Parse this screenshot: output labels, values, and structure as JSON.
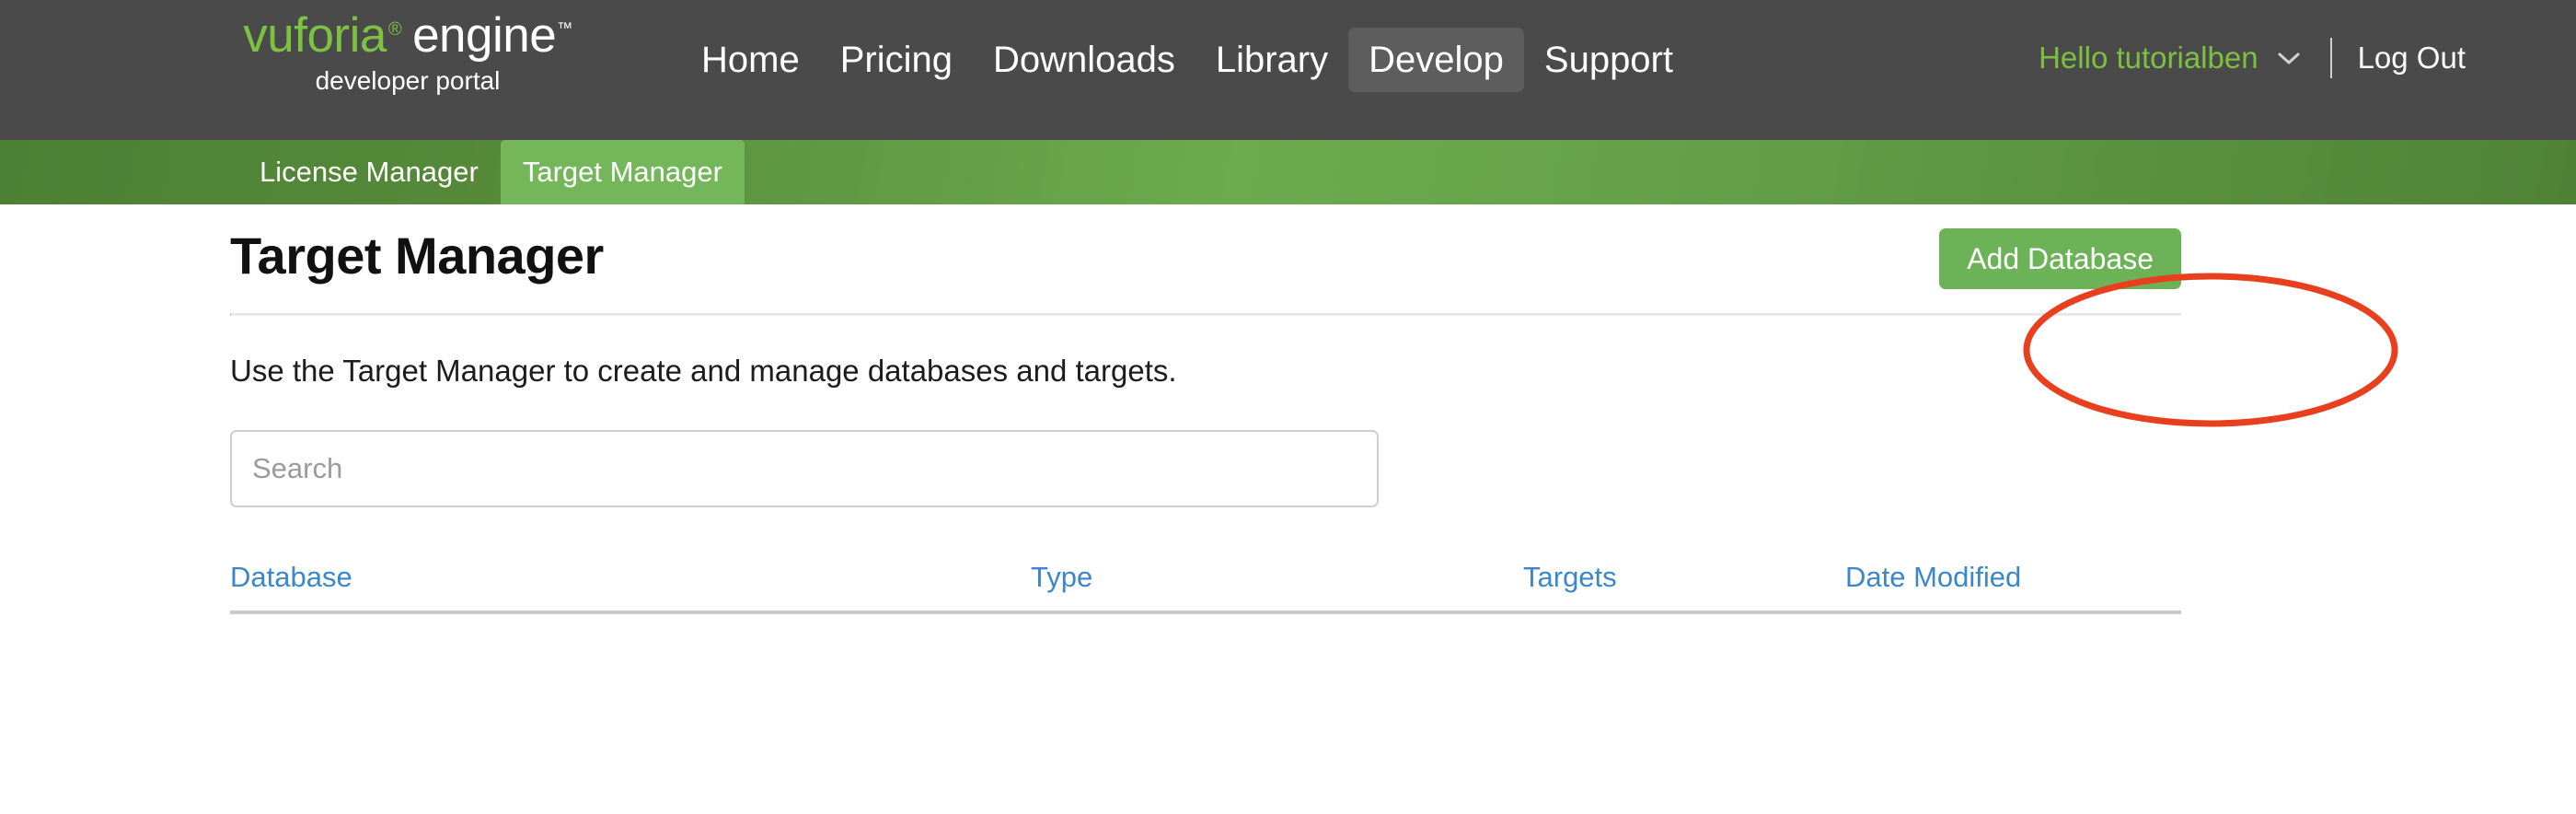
{
  "header": {
    "logo": {
      "brand": "vuforia",
      "registered_mark": "®",
      "product": "engine",
      "trademark_mark": "™",
      "subtitle": "developer portal"
    },
    "nav_items": [
      {
        "label": "Home",
        "active": false
      },
      {
        "label": "Pricing",
        "active": false
      },
      {
        "label": "Downloads",
        "active": false
      },
      {
        "label": "Library",
        "active": false
      },
      {
        "label": "Develop",
        "active": true
      },
      {
        "label": "Support",
        "active": false
      }
    ],
    "account": {
      "greeting": "Hello tutorialben",
      "dropdown_icon": "chevron-down-icon",
      "logout_label": "Log Out"
    },
    "colors": {
      "bar_background": "#4a4a4a",
      "active_tab_background": "#5d5d5d",
      "brand_green": "#7cc142"
    }
  },
  "subnav": {
    "tabs": [
      {
        "label": "License Manager",
        "active": false
      },
      {
        "label": "Target Manager",
        "active": true
      }
    ],
    "colors": {
      "gradient_dark": "#4c8034",
      "gradient_light": "#6cab4e",
      "active_tab_background": "#74b75b"
    }
  },
  "main": {
    "page_title": "Target Manager",
    "add_database_button": "Add Database",
    "lead_text": "Use the Target Manager to create and manage databases and targets.",
    "search": {
      "placeholder": "Search",
      "value": ""
    },
    "table": {
      "columns": [
        {
          "label": "Database"
        },
        {
          "label": "Type"
        },
        {
          "label": "Targets"
        },
        {
          "label": "Date Modified"
        }
      ],
      "rows": []
    },
    "colors": {
      "button_green": "#6cb257",
      "link_blue": "#3b87c9",
      "rule_gray": "#c9c9c9"
    }
  },
  "annotation": {
    "shape": "ellipse",
    "target": "Add Database",
    "color": "#e8401f",
    "stroke_width": 7
  }
}
